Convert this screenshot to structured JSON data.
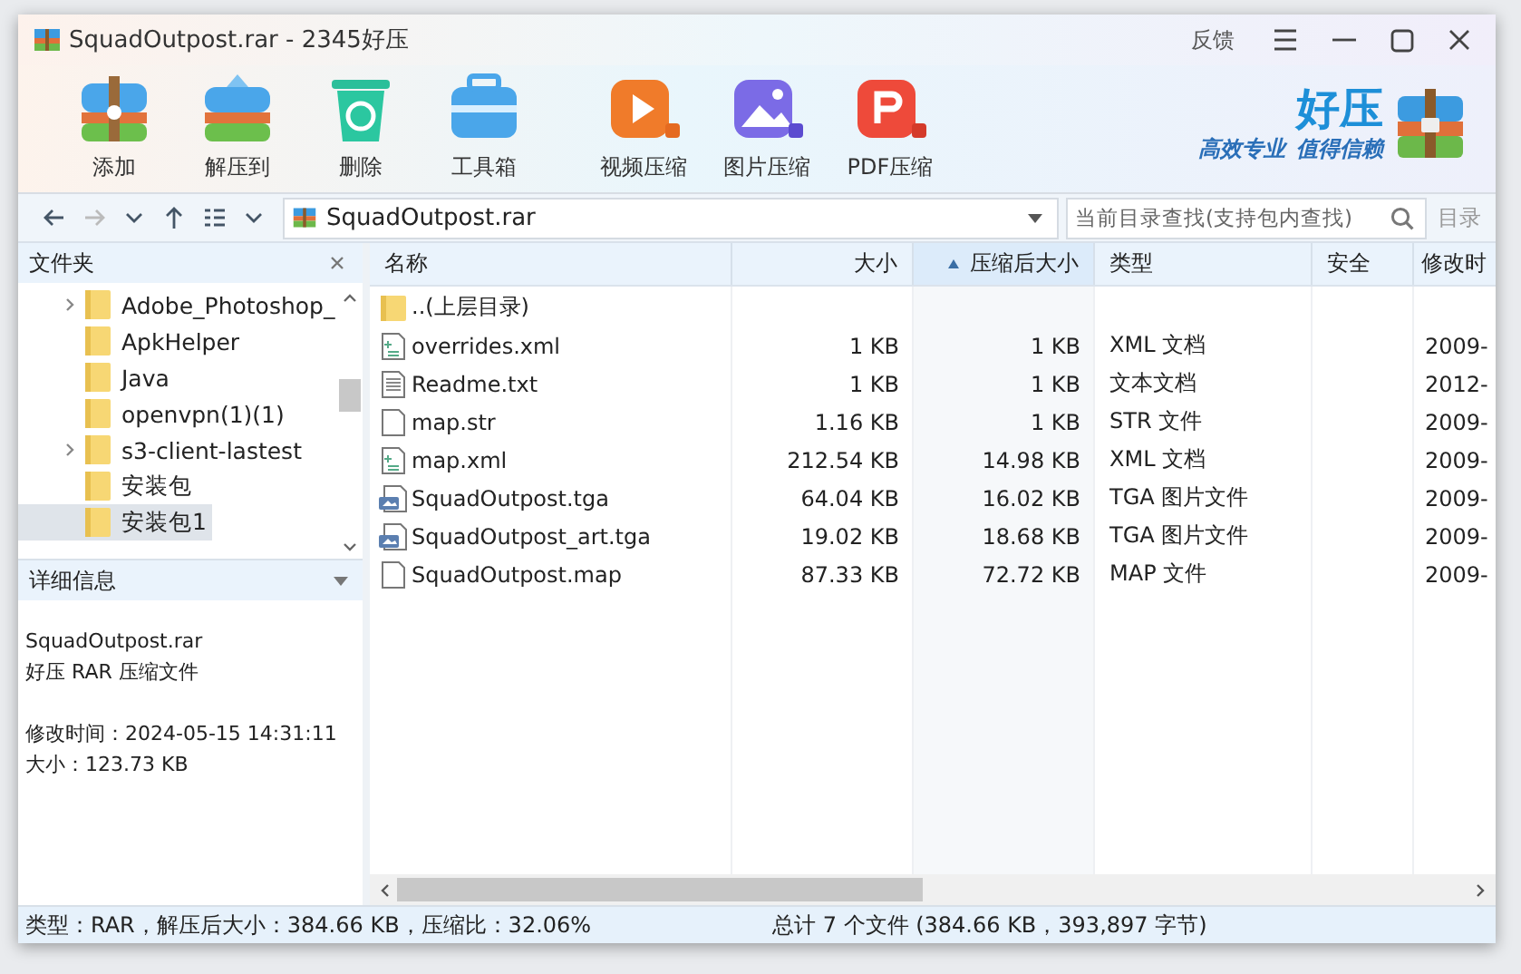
{
  "window": {
    "title": "SquadOutpost.rar - 2345好压",
    "feedback": "反馈"
  },
  "toolbar": {
    "buttons": [
      {
        "label": "添加",
        "kind": "add"
      },
      {
        "label": "解压到",
        "kind": "extract"
      },
      {
        "label": "删除",
        "kind": "delete"
      },
      {
        "label": "工具箱",
        "kind": "tools"
      },
      {
        "label": "视频压缩",
        "kind": "video"
      },
      {
        "label": "图片压缩",
        "kind": "image"
      },
      {
        "label": "PDF压缩",
        "kind": "pdf"
      }
    ],
    "brand": {
      "name": "好压",
      "slogan_1": "高效专业",
      "slogan_2": "值得信赖"
    }
  },
  "address_bar": {
    "path": "SquadOutpost.rar",
    "search_placeholder": "当前目录查找(支持包内查找)",
    "search_scope": "目录"
  },
  "folder_panel": {
    "title": "文件夹",
    "items": [
      {
        "label": "Adobe_Photoshop_",
        "expandable": true,
        "selected": false
      },
      {
        "label": "ApkHelper",
        "expandable": false,
        "selected": false
      },
      {
        "label": "Java",
        "expandable": false,
        "selected": false
      },
      {
        "label": "openvpn(1)(1)",
        "expandable": false,
        "selected": false
      },
      {
        "label": "s3-client-lastest",
        "expandable": true,
        "selected": false
      },
      {
        "label": "安装包",
        "expandable": false,
        "selected": false
      },
      {
        "label": "安装包1",
        "expandable": false,
        "selected": true
      }
    ]
  },
  "details": {
    "title": "详细信息",
    "name": "SquadOutpost.rar",
    "type": "好压 RAR 压缩文件",
    "modified": "修改时间：2024-05-15 14:31:11",
    "size": "大小：123.73 KB"
  },
  "table": {
    "columns": [
      {
        "label": "名称",
        "sorted": false
      },
      {
        "label": "大小",
        "sorted": false
      },
      {
        "label": "压缩后大小",
        "sorted": true
      },
      {
        "label": "类型",
        "sorted": false
      },
      {
        "label": "安全",
        "sorted": false
      },
      {
        "label": "修改时",
        "sorted": false
      }
    ],
    "rows": [
      {
        "kind": "folder",
        "name": "..(上层目录)"
      },
      {
        "kind": "xml",
        "name": "overrides.xml",
        "size": "1 KB",
        "packed": "1 KB",
        "type": "XML 文档",
        "modified": "2009-"
      },
      {
        "kind": "text",
        "name": "Readme.txt",
        "size": "1 KB",
        "packed": "1 KB",
        "type": "文本文档",
        "modified": "2012-"
      },
      {
        "kind": "blank",
        "name": "map.str",
        "size": "1.16 KB",
        "packed": "1 KB",
        "type": "STR 文件",
        "modified": "2009-"
      },
      {
        "kind": "xml",
        "name": "map.xml",
        "size": "212.54 KB",
        "packed": "14.98 KB",
        "type": "XML 文档",
        "modified": "2009-"
      },
      {
        "kind": "image",
        "name": "SquadOutpost.tga",
        "size": "64.04 KB",
        "packed": "16.02 KB",
        "type": "TGA 图片文件",
        "modified": "2009-"
      },
      {
        "kind": "image",
        "name": "SquadOutpost_art.tga",
        "size": "19.02 KB",
        "packed": "18.68 KB",
        "type": "TGA 图片文件",
        "modified": "2009-"
      },
      {
        "kind": "blank",
        "name": "SquadOutpost.map",
        "size": "87.33 KB",
        "packed": "72.72 KB",
        "type": "MAP 文件",
        "modified": "2009-"
      }
    ]
  },
  "status_bar": {
    "left": "类型：RAR，解压后大小：384.66 KB，压缩比：32.06%",
    "right": "总计 7 个文件 (384.66 KB，393,897 字节)"
  }
}
